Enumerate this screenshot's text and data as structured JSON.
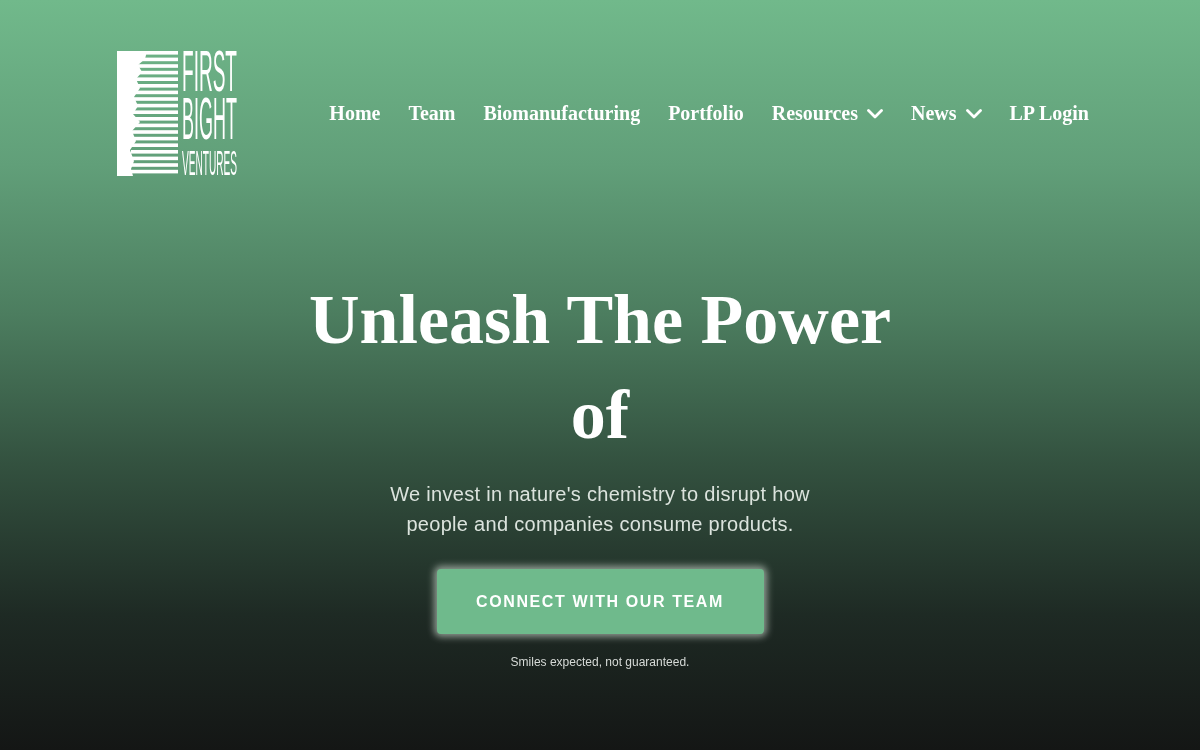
{
  "logo": {
    "lines": [
      "FIRST",
      "BIGHT",
      "VENTURES"
    ]
  },
  "nav": [
    {
      "label": "Home",
      "dropdown": false
    },
    {
      "label": "Team",
      "dropdown": false
    },
    {
      "label": "Biomanufacturing",
      "dropdown": false
    },
    {
      "label": "Portfolio",
      "dropdown": false
    },
    {
      "label": "Resources",
      "dropdown": true
    },
    {
      "label": "News",
      "dropdown": true
    },
    {
      "label": "LP Login",
      "dropdown": false
    }
  ],
  "hero": {
    "title": "Unleash The Power of",
    "subtitle": "We invest in nature's chemistry to disrupt how people and companies consume products.",
    "button": "CONNECT WITH OUR TEAM",
    "note": "Smiles expected, not guaranteed."
  }
}
